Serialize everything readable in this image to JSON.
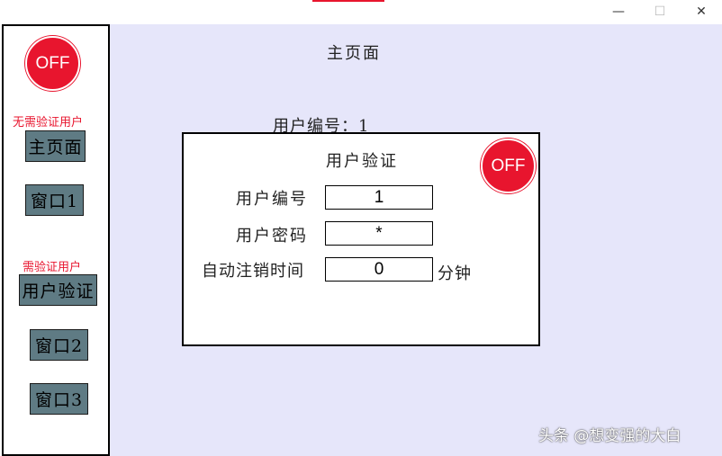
{
  "window": {
    "minimize": "—",
    "maximize": "☐",
    "close": "✕"
  },
  "sidebar": {
    "off_button": "OFF",
    "group1_label": "无需验证用户",
    "group2_label": "需验证用户",
    "items": [
      {
        "label": "主页面"
      },
      {
        "label": "窗口1"
      },
      {
        "label": "用户验证"
      },
      {
        "label": "窗口2"
      },
      {
        "label": "窗口3"
      }
    ]
  },
  "main": {
    "title": "主页面",
    "user_number_text": "用户编号：1"
  },
  "dialog": {
    "title": "用户验证",
    "off_button": "OFF",
    "fields": [
      {
        "label": "用户编号",
        "value": "1"
      },
      {
        "label": "用户密码",
        "value": "*"
      },
      {
        "label": "自动注销时间",
        "value": "0",
        "unit": "分钟"
      }
    ]
  },
  "watermark": "头条 @想变强的大白",
  "colors": {
    "accent_red": "#e8152e",
    "main_background": "#e6e6fa",
    "nav_button": "#5f7b84"
  }
}
